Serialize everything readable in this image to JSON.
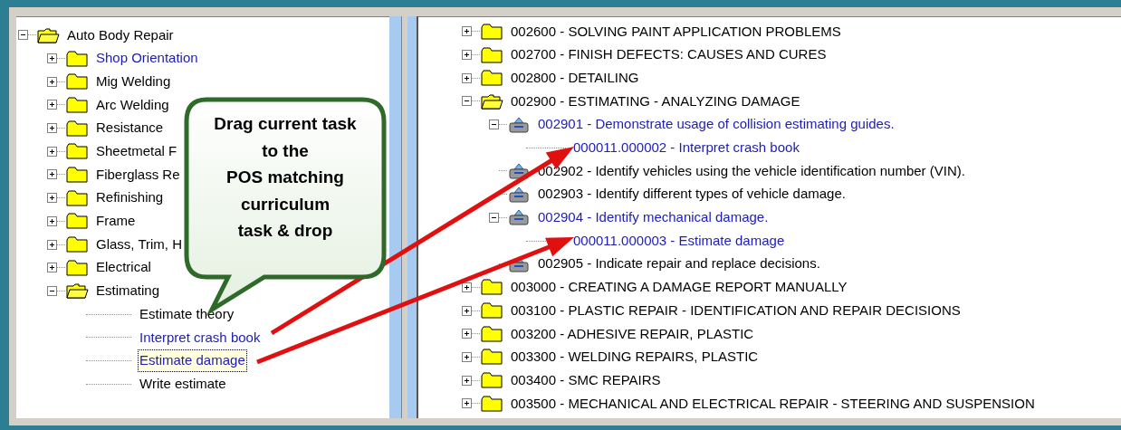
{
  "left_tree": {
    "items": [
      {
        "label": "Auto Body Repair",
        "kind": "folder",
        "expanded": true,
        "linked": false,
        "children": [
          {
            "label": "Shop Orientation",
            "kind": "folder",
            "expanded": false,
            "linked": true
          },
          {
            "label": "Mig Welding",
            "kind": "folder",
            "expanded": false,
            "linked": false
          },
          {
            "label": "Arc Welding",
            "kind": "folder",
            "expanded": false,
            "linked": false
          },
          {
            "label": "Resistance",
            "kind": "folder",
            "expanded": false,
            "linked": false
          },
          {
            "label": "Sheetmetal F",
            "kind": "folder",
            "expanded": false,
            "linked": false
          },
          {
            "label": "Fiberglass Re",
            "kind": "folder",
            "expanded": false,
            "linked": false
          },
          {
            "label": "Refinishing",
            "kind": "folder",
            "expanded": false,
            "linked": false
          },
          {
            "label": "Frame",
            "kind": "folder",
            "expanded": false,
            "linked": false
          },
          {
            "label": "Glass, Trim, H",
            "kind": "folder",
            "expanded": false,
            "linked": false
          },
          {
            "label": "Electrical",
            "kind": "folder",
            "expanded": false,
            "linked": false
          },
          {
            "label": "Estimating",
            "kind": "folder",
            "expanded": true,
            "linked": false,
            "children": [
              {
                "label": "Estimate theory",
                "kind": "item",
                "linked": false,
                "focused": false
              },
              {
                "label": "Interpret crash book",
                "kind": "item",
                "linked": true,
                "focused": false
              },
              {
                "label": "Estimate damage",
                "kind": "item",
                "linked": true,
                "focused": true
              },
              {
                "label": "Write estimate",
                "kind": "item",
                "linked": false,
                "focused": false
              }
            ]
          }
        ]
      }
    ]
  },
  "right_tree": {
    "items": [
      {
        "label": "002600 - SOLVING PAINT APPLICATION PROBLEMS",
        "kind": "folder",
        "expanded": false,
        "linked": false
      },
      {
        "label": "002700 - FINISH DEFECTS:  CAUSES AND CURES",
        "kind": "folder",
        "expanded": false,
        "linked": false
      },
      {
        "label": "002800 - DETAILING",
        "kind": "folder",
        "expanded": false,
        "linked": false
      },
      {
        "label": "002900 - ESTIMATING - ANALYZING DAMAGE",
        "kind": "folder",
        "expanded": true,
        "linked": false,
        "children": [
          {
            "label": "002901 - Demonstrate usage of collision estimating guides.",
            "kind": "task",
            "expanded": true,
            "linked": true,
            "children": [
              {
                "label": "000011.000002 - Interpret crash book",
                "kind": "item",
                "linked": true
              }
            ]
          },
          {
            "label": "002902 - Identify vehicles using the vehicle identification number (VIN).",
            "kind": "task",
            "linked": false
          },
          {
            "label": "002903 - Identify different types of vehicle damage.",
            "kind": "task",
            "linked": false
          },
          {
            "label": "002904 - Identify mechanical damage.",
            "kind": "task",
            "expanded": true,
            "linked": true,
            "children": [
              {
                "label": "000011.000003 - Estimate damage",
                "kind": "item",
                "linked": true
              }
            ]
          },
          {
            "label": "002905 - Indicate repair and replace decisions.",
            "kind": "task",
            "linked": false
          }
        ]
      },
      {
        "label": "003000 - CREATING A DAMAGE REPORT MANUALLY",
        "kind": "folder",
        "expanded": false,
        "linked": false
      },
      {
        "label": "003100 - PLASTIC REPAIR - IDENTIFICATION AND REPAIR DECISIONS",
        "kind": "folder",
        "expanded": false,
        "linked": false
      },
      {
        "label": "003200 - ADHESIVE REPAIR, PLASTIC",
        "kind": "folder",
        "expanded": false,
        "linked": false
      },
      {
        "label": "003300 - WELDING REPAIRS, PLASTIC",
        "kind": "folder",
        "expanded": false,
        "linked": false
      },
      {
        "label": "003400 - SMC REPAIRS",
        "kind": "folder",
        "expanded": false,
        "linked": false
      },
      {
        "label": "003500 - MECHANICAL AND ELECTRICAL REPAIR - STEERING AND SUSPENSION",
        "kind": "folder",
        "expanded": false,
        "linked": false
      }
    ]
  },
  "callout": {
    "text": "Drag current task\nto the\nPOS matching\ncurriculum\ntask & drop"
  }
}
